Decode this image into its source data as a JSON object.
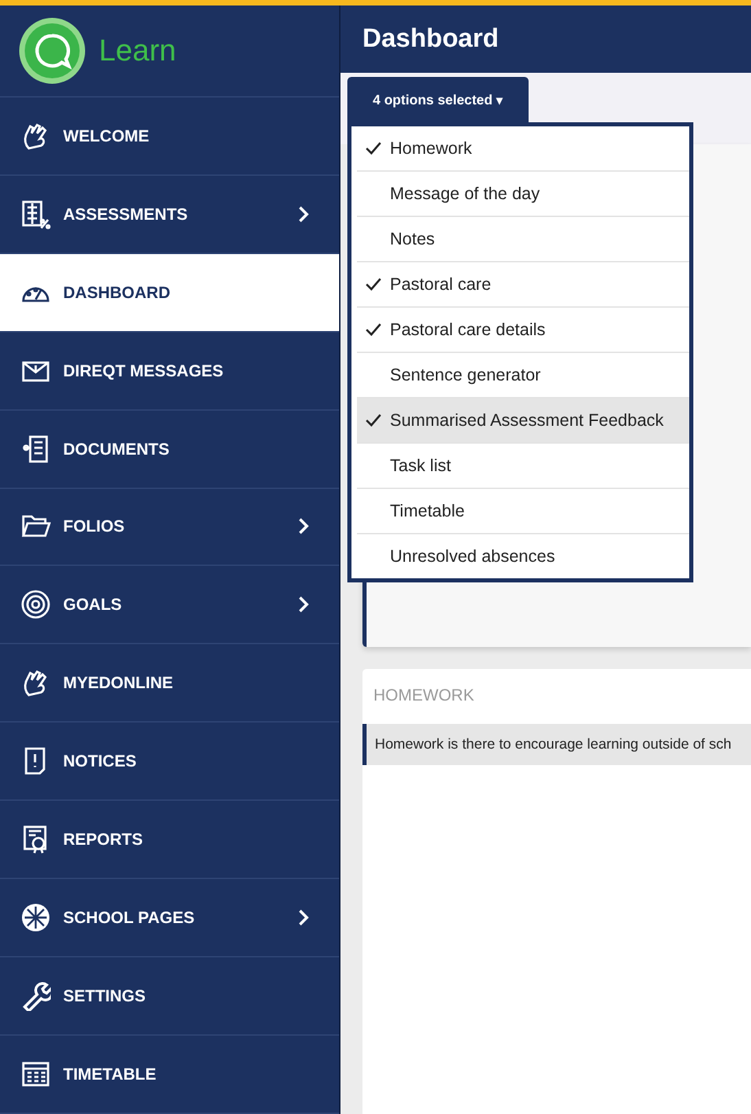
{
  "app": {
    "name": "Learn"
  },
  "sidebar": {
    "items": [
      {
        "label": "WELCOME",
        "selected": false,
        "expandable": false
      },
      {
        "label": "ASSESSMENTS",
        "selected": false,
        "expandable": true
      },
      {
        "label": "DASHBOARD",
        "selected": true,
        "expandable": false
      },
      {
        "label": "DIREQT MESSAGES",
        "selected": false,
        "expandable": false
      },
      {
        "label": "DOCUMENTS",
        "selected": false,
        "expandable": false
      },
      {
        "label": "FOLIOS",
        "selected": false,
        "expandable": true
      },
      {
        "label": "GOALS",
        "selected": false,
        "expandable": true
      },
      {
        "label": "MYEDONLINE",
        "selected": false,
        "expandable": false
      },
      {
        "label": "NOTICES",
        "selected": false,
        "expandable": false
      },
      {
        "label": "REPORTS",
        "selected": false,
        "expandable": false
      },
      {
        "label": "SCHOOL PAGES",
        "selected": false,
        "expandable": true
      },
      {
        "label": "SETTINGS",
        "selected": false,
        "expandable": false
      },
      {
        "label": "TIMETABLE",
        "selected": false,
        "expandable": false
      }
    ]
  },
  "header": {
    "title": "Dashboard"
  },
  "widget_select": {
    "label": "4 options selected",
    "caret": "▾",
    "options": [
      {
        "label": "Homework",
        "checked": true,
        "highlighted": false
      },
      {
        "label": "Message of the day",
        "checked": false,
        "highlighted": false
      },
      {
        "label": "Notes",
        "checked": false,
        "highlighted": false
      },
      {
        "label": "Pastoral care",
        "checked": true,
        "highlighted": false
      },
      {
        "label": "Pastoral care details",
        "checked": true,
        "highlighted": false
      },
      {
        "label": "Sentence generator",
        "checked": false,
        "highlighted": false
      },
      {
        "label": "Summarised Assessment Feedback",
        "checked": true,
        "highlighted": true
      },
      {
        "label": "Task list",
        "checked": false,
        "highlighted": false
      },
      {
        "label": "Timetable",
        "checked": false,
        "highlighted": false
      },
      {
        "label": "Unresolved absences",
        "checked": false,
        "highlighted": false
      }
    ]
  },
  "homework_card": {
    "title": "HOMEWORK",
    "message": "Homework is there to encourage learning outside of sch"
  }
}
